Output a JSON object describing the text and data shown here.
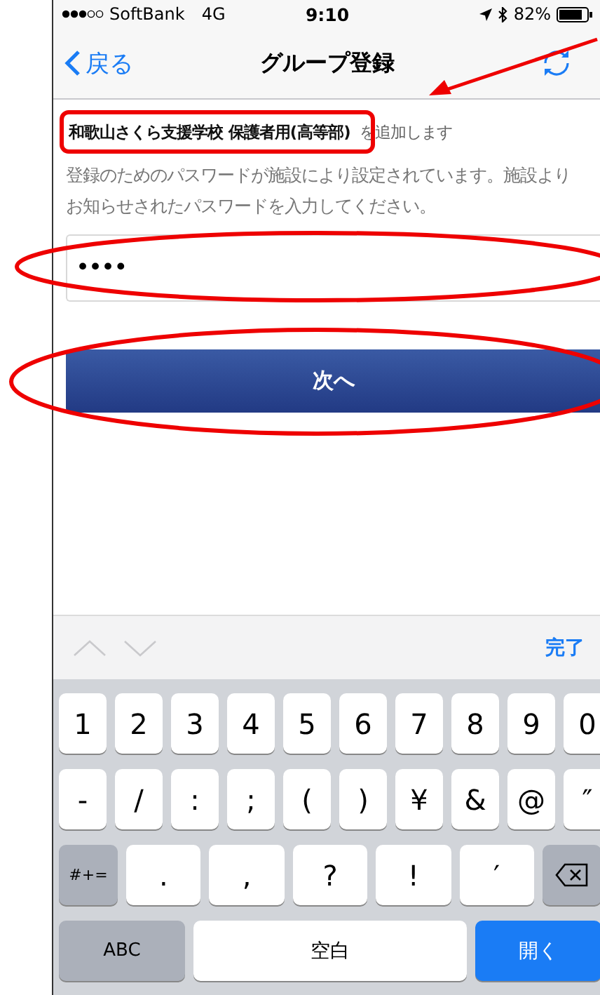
{
  "status_bar": {
    "carrier": "SoftBank",
    "network": "4G",
    "time": "9:10",
    "battery": "82%"
  },
  "nav": {
    "back": "戻る",
    "title": "グループ登録"
  },
  "form": {
    "heading": "**和歌山さくら支援学校 保護者用(高等部)**を追加します",
    "description": "登録のためのパスワードが施設により設定されています。施設よりお知らせされたパスワードを入力してください。",
    "password_field": {
      "value": "••••"
    },
    "next_button": "次へ"
  },
  "keyboard_toolbar": {
    "done": "完了"
  },
  "keyboard": {
    "rows": [
      {
        "keys": [
          {
            "kind": "char",
            "label": "1"
          },
          {
            "kind": "char",
            "label": "2"
          },
          {
            "kind": "char",
            "label": "3"
          },
          {
            "kind": "char",
            "label": "4"
          },
          {
            "kind": "char",
            "label": "5"
          },
          {
            "kind": "char",
            "label": "6"
          },
          {
            "kind": "char",
            "label": "7"
          },
          {
            "kind": "char",
            "label": "8"
          },
          {
            "kind": "char",
            "label": "9"
          },
          {
            "kind": "char",
            "label": "0"
          }
        ]
      },
      {
        "keys": [
          {
            "kind": "char",
            "label": "-"
          },
          {
            "kind": "char",
            "label": "/"
          },
          {
            "kind": "char",
            "label": ":"
          },
          {
            "kind": "char",
            "label": ";"
          },
          {
            "kind": "char",
            "label": "("
          },
          {
            "kind": "char",
            "label": ")"
          },
          {
            "kind": "char",
            "label": "¥"
          },
          {
            "kind": "char",
            "label": "&"
          },
          {
            "kind": "char",
            "label": "@"
          },
          {
            "kind": "char",
            "label": "″"
          }
        ]
      },
      {
        "keys": [
          {
            "kind": "mode",
            "label": "#+="
          },
          {
            "kind": "char",
            "label": "."
          },
          {
            "kind": "char",
            "label": ","
          },
          {
            "kind": "char",
            "label": "?"
          },
          {
            "kind": "char",
            "label": "!"
          },
          {
            "kind": "char",
            "label": "′"
          },
          {
            "kind": "delete"
          }
        ]
      },
      {
        "keys": [
          {
            "kind": "mode",
            "label": "ABC"
          },
          {
            "kind": "space",
            "label": "空白"
          },
          {
            "kind": "action",
            "label": "開く"
          }
        ]
      }
    ]
  },
  "annotations": [
    {
      "kind": "arrow"
    },
    {
      "kind": "box"
    },
    {
      "kind": "ellipse"
    },
    {
      "kind": "ellipse"
    }
  ]
}
